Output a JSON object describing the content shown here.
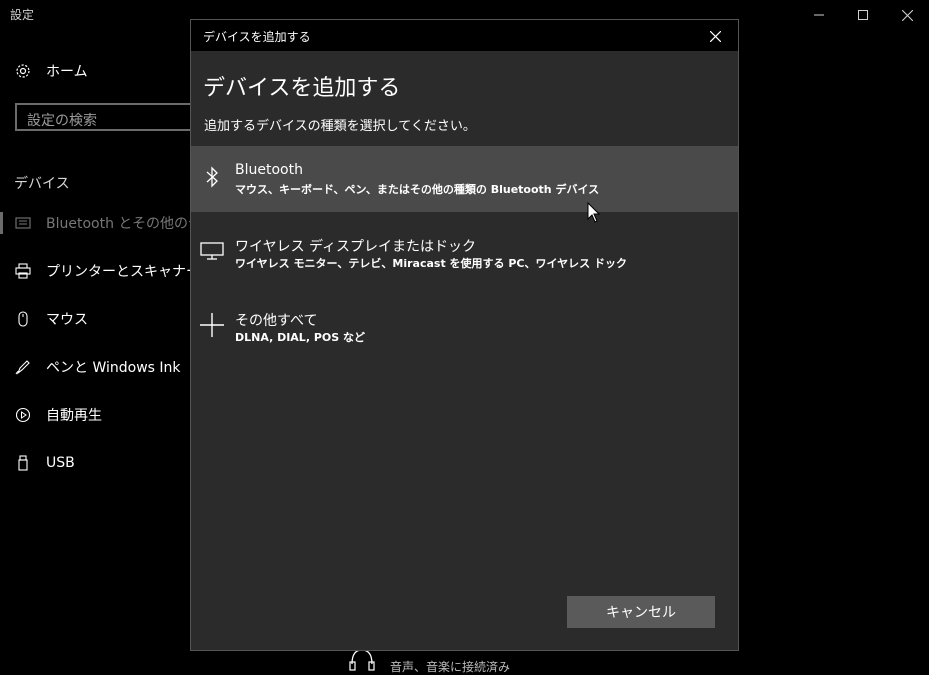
{
  "app": {
    "title": "設定"
  },
  "sidebar": {
    "home_label": "ホーム",
    "search_placeholder": "設定の検索",
    "section_title": "デバイス",
    "items": [
      {
        "label": "Bluetooth とその他のデバイス",
        "icon": "bluetooth-devices-icon"
      },
      {
        "label": "プリンターとスキャナー",
        "icon": "printer-icon"
      },
      {
        "label": "マウス",
        "icon": "mouse-icon"
      },
      {
        "label": "ペンと Windows Ink",
        "icon": "pen-icon"
      },
      {
        "label": "自動再生",
        "icon": "autoplay-icon"
      },
      {
        "label": "USB",
        "icon": "usb-icon"
      }
    ]
  },
  "background": {
    "peek_text": "音声、音楽に接続済み"
  },
  "dialog": {
    "window_title": "デバイスを追加する",
    "heading": "デバイスを追加する",
    "subtitle": "追加するデバイスの種類を選択してください。",
    "options": [
      {
        "title": "Bluetooth",
        "description": "マウス、キーボード、ペン、またはその他の種類の Bluetooth デバイス",
        "icon": "bluetooth-icon"
      },
      {
        "title": "ワイヤレス ディスプレイまたはドック",
        "description": "ワイヤレス モニター、テレビ、Miracast を使用する PC、ワイヤレス ドック",
        "icon": "monitor-icon"
      },
      {
        "title": "その他すべて",
        "description": "DLNA, DIAL, POS など",
        "icon": "plus-icon"
      }
    ],
    "cancel_label": "キャンセル"
  },
  "colors": {
    "dialog_bg": "#2b2b2b",
    "hover_bg": "#4a4a4a",
    "button_bg": "#5a5a5a"
  }
}
